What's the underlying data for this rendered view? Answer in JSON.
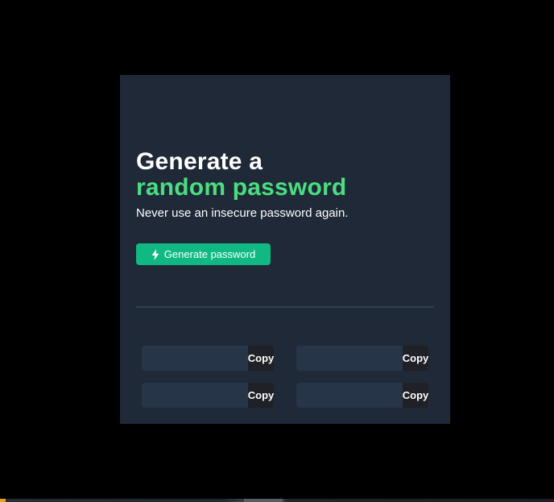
{
  "colors": {
    "background": "#000000",
    "card": "#1f2937",
    "accent_green": "#4ade80",
    "button_green": "#10b981",
    "field": "#273549",
    "copy_button": "#1f2126"
  },
  "header": {
    "title_line1": "Generate a",
    "title_line2": "random password",
    "subtitle": "Never use an insecure password again."
  },
  "actions": {
    "generate_icon": "lightning-bolt-icon",
    "generate_label": "Generate password"
  },
  "passwords": [
    {
      "value": "",
      "copy_label": "Copy"
    },
    {
      "value": "",
      "copy_label": "Copy"
    },
    {
      "value": "",
      "copy_label": "Copy"
    },
    {
      "value": "",
      "copy_label": "Copy"
    }
  ]
}
